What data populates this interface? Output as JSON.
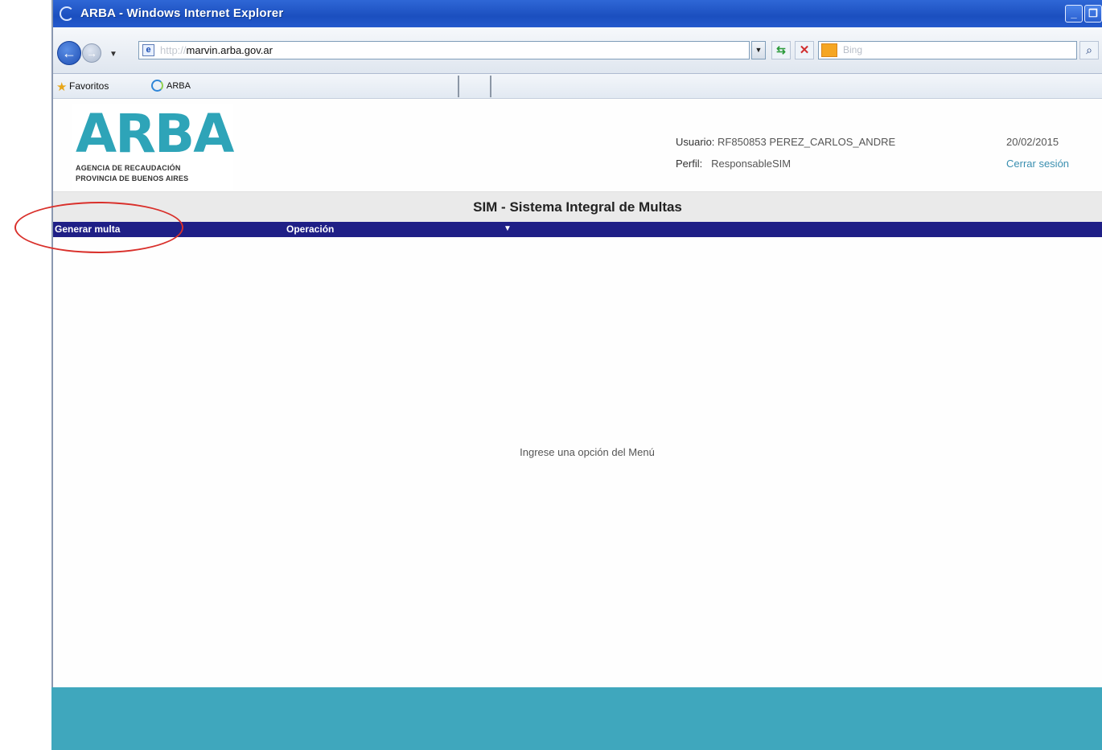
{
  "window": {
    "title": "ARBA - Windows Internet Explorer",
    "minimize_glyph": "_",
    "restore_glyph": "❐"
  },
  "navbar": {
    "back_glyph": "←",
    "forward_glyph": "→",
    "dropdown_glyph": "▼",
    "url_visible": "marvin.arba.gov.ar",
    "url_prefix": "http://",
    "refresh_glyph": "⇆",
    "stop_glyph": "✕",
    "search_placeholder": "Bing",
    "search_glyph": "⌕"
  },
  "favorites": {
    "label": "Favoritos",
    "tab_label": "ARBA",
    "star_glyph": "★"
  },
  "header": {
    "logo_text": "ARBA",
    "logo_line1": "AGENCIA DE RECAUDACIÓN",
    "logo_line2": "PROVINCIA DE BUENOS AIRES",
    "user_label": "Usuario:",
    "user_value": "RF850853 PEREZ_CARLOS_ANDRE",
    "profile_label": "Perfil:",
    "profile_value": "ResponsableSIM",
    "date": "20/02/2015",
    "logout": "Cerrar sesión"
  },
  "app": {
    "title": "SIM - Sistema Integral de Multas",
    "menu": [
      {
        "label": "Generar multa"
      },
      {
        "label": "Operación"
      }
    ],
    "menu_arrow": "▼",
    "empty_message": "Ingrese una opción del Menú"
  },
  "colors": {
    "menu_bar": "#1f1f86",
    "brand": "#2ea4b8",
    "footer": "#3fa7bd",
    "highlight": "#d9302b"
  }
}
